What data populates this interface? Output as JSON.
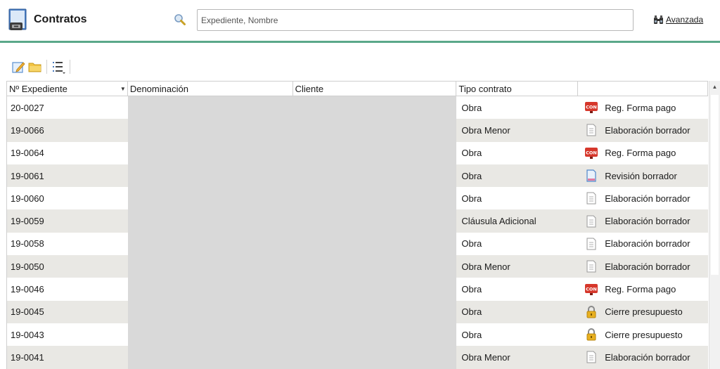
{
  "header": {
    "title": "Contratos",
    "search_placeholder": "Expediente, Nombre",
    "search_value": "",
    "advanced_label": "Avanzada",
    "accent_color": "#5aa88a"
  },
  "toolbar": {
    "buttons": [
      "edit-icon",
      "folder-icon",
      "list-options-icon"
    ]
  },
  "grid": {
    "columns": [
      "Nº Expediente",
      "Denominación",
      "Cliente",
      "Tipo contrato",
      ""
    ],
    "sorted_column": "Nº Expediente",
    "rows": [
      {
        "expediente": "20-0027",
        "denominacion": "",
        "cliente": "",
        "tipo": "Obra",
        "estado_icon": "con-icon",
        "estado": "Reg. Forma pago"
      },
      {
        "expediente": "19-0066",
        "denominacion": "",
        "cliente": "",
        "tipo": "Obra Menor",
        "estado_icon": "document-icon",
        "estado": "Elaboración borrador"
      },
      {
        "expediente": "19-0064",
        "denominacion": "",
        "cliente": "",
        "tipo": "Obra",
        "estado_icon": "con-icon",
        "estado": "Reg. Forma pago"
      },
      {
        "expediente": "19-0061",
        "denominacion": "",
        "cliente": "",
        "tipo": "Obra",
        "estado_icon": "review-document-icon",
        "estado": "Revisión borrador"
      },
      {
        "expediente": "19-0060",
        "denominacion": "",
        "cliente": "",
        "tipo": "Obra",
        "estado_icon": "document-icon",
        "estado": "Elaboración borrador"
      },
      {
        "expediente": "19-0059",
        "denominacion": "",
        "cliente": "",
        "tipo": "Cláusula Adicional",
        "estado_icon": "document-icon",
        "estado": "Elaboración borrador"
      },
      {
        "expediente": "19-0058",
        "denominacion": "",
        "cliente": "",
        "tipo": "Obra",
        "estado_icon": "document-icon",
        "estado": "Elaboración borrador"
      },
      {
        "expediente": "19-0050",
        "denominacion": "",
        "cliente": "",
        "tipo": "Obra Menor",
        "estado_icon": "document-icon",
        "estado": "Elaboración borrador"
      },
      {
        "expediente": "19-0046",
        "denominacion": "",
        "cliente": "",
        "tipo": "Obra",
        "estado_icon": "con-icon",
        "estado": "Reg. Forma pago"
      },
      {
        "expediente": "19-0045",
        "denominacion": "",
        "cliente": "",
        "tipo": "Obra",
        "estado_icon": "lock-icon",
        "estado": "Cierre presupuesto"
      },
      {
        "expediente": "19-0043",
        "denominacion": "",
        "cliente": "",
        "tipo": "Obra",
        "estado_icon": "lock-icon",
        "estado": "Cierre presupuesto"
      },
      {
        "expediente": "19-0041",
        "denominacion": "",
        "cliente": "",
        "tipo": "Obra Menor",
        "estado_icon": "document-icon",
        "estado": "Elaboración borrador"
      }
    ]
  },
  "icons": {
    "con_badge_text": "CON"
  },
  "colors": {
    "row_alt": "#e9e8e4",
    "redacted": "#d9d9d9",
    "con_red": "#d6372b",
    "lock_yellow": "#e8b020"
  }
}
